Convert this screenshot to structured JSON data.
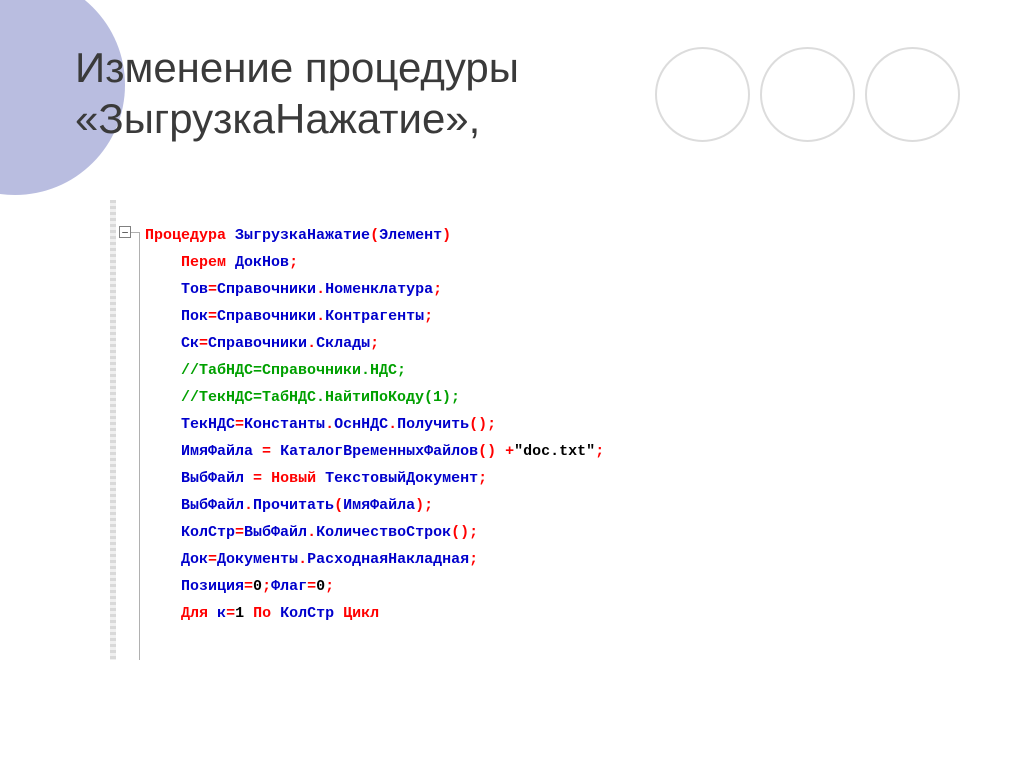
{
  "title": {
    "line1": "Изменение процедуры",
    "line2": "«ЗыгрузкаНажатие»,"
  },
  "code": {
    "ind": "    ",
    "l1": {
      "a": "Процедура",
      "b": "ЗыгрузкаНажатие",
      "c": "(",
      "d": "Элемент",
      "e": ")"
    },
    "l2": {
      "a": "Перем",
      "b": "ДокНов",
      "c": ";"
    },
    "l3": {
      "a": "Тов",
      "b": "=",
      "c": "Справочники",
      "d": ".",
      "e": "Номенклатура",
      "f": ";"
    },
    "l4": {
      "a": "Пок",
      "b": "=",
      "c": "Справочники",
      "d": ".",
      "e": "Контрагенты",
      "f": ";"
    },
    "l5": {
      "a": "Ск",
      "b": "=",
      "c": "Справочники",
      "d": ".",
      "e": "Склады",
      "f": ";"
    },
    "l6": {
      "a": "//ТабНДС=Справочники.НДС;"
    },
    "l7": {
      "a": "//ТекНДС=ТабНДС.НайтиПоКоду(1);"
    },
    "l8": {
      "a": "ТекНДС",
      "b": "=",
      "c": "Константы",
      "d": ".",
      "e": "ОснНДС",
      "f": ".",
      "g": "Получить",
      "h": "();"
    },
    "l9": {
      "a": "ИмяФайла",
      "b": "=",
      "c": "КаталогВременныхФайлов",
      "d": "()",
      "e": "+",
      "f": "\"doc.txt\"",
      "g": ";"
    },
    "l10": {
      "a": "ВыбФайл",
      "b": "=",
      "c": "Новый",
      "d": "ТекстовыйДокумент",
      "e": ";"
    },
    "l11": {
      "a": "ВыбФайл",
      "b": ".",
      "c": "Прочитать",
      "d": "(",
      "e": "ИмяФайла",
      "f": ");"
    },
    "l12": {
      "a": "КолСтр",
      "b": "=",
      "c": "ВыбФайл",
      "d": ".",
      "e": "КоличествоСтрок",
      "f": "();"
    },
    "l13": {
      "a": "Док",
      "b": "=",
      "c": "Документы",
      "d": ".",
      "e": "РасходнаяНакладная",
      "f": ";"
    },
    "l14": {
      "a": "Позиция",
      "b": "=",
      "c": "0",
      "d": ";",
      "e": "Флаг",
      "f": "=",
      "g": "0",
      "h": ";"
    },
    "l15": {
      "a": "Для",
      "b": "к",
      "c": "=",
      "d": "1",
      "e": "По",
      "f": "КолСтр",
      "g": "Цикл"
    }
  }
}
